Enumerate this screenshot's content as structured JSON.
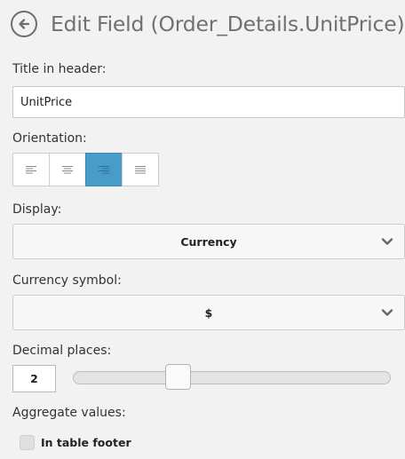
{
  "header": {
    "title": "Edit Field (Order_Details.UnitPrice)",
    "back_icon": "back-arrow-circle-icon"
  },
  "title_in_header": {
    "label": "Title in header:",
    "value": "UnitPrice"
  },
  "orientation": {
    "label": "Orientation:",
    "options": [
      "left",
      "center",
      "right",
      "justify"
    ],
    "selected": "right"
  },
  "display": {
    "label": "Display:",
    "selected": "Currency"
  },
  "currency_symbol": {
    "label": "Currency symbol:",
    "selected": "$"
  },
  "decimal_places": {
    "label": "Decimal places:",
    "value": "2",
    "slider_fraction": 0.33
  },
  "aggregate": {
    "label": "Aggregate values:",
    "table_footer_label": "In table footer",
    "table_footer_checked": false
  },
  "colors": {
    "accent": "#4a9cc8",
    "background": "#f2f2f2"
  }
}
